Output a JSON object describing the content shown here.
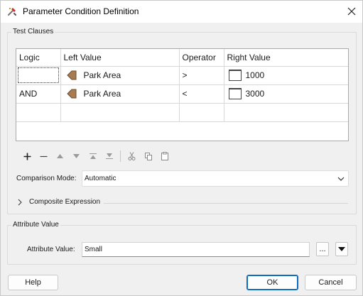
{
  "window": {
    "title": "Parameter Condition Definition",
    "icon": "fme-tool-icon"
  },
  "test_clauses": {
    "group_label": "Test Clauses",
    "columns": [
      "Logic",
      "Left Value",
      "Operator",
      "Right Value"
    ],
    "rows": [
      {
        "logic": "",
        "left_value": "Park Area",
        "left_icon": "attribute-icon",
        "operator": ">",
        "right_value": "1000",
        "right_icon": "constant-box-icon"
      },
      {
        "logic": "AND",
        "left_value": "Park Area",
        "left_icon": "attribute-icon",
        "operator": "<",
        "right_value": "3000",
        "right_icon": "constant-box-icon"
      },
      {
        "logic": "",
        "left_value": "",
        "left_icon": "",
        "operator": "",
        "right_value": "",
        "right_icon": ""
      }
    ],
    "toolbar": [
      "add-icon",
      "remove-icon",
      "move-up-icon",
      "move-down-icon",
      "move-to-top-icon",
      "move-to-bottom-icon",
      "cut-icon",
      "copy-icon",
      "paste-icon"
    ],
    "comparison_mode_label": "Comparison Mode:",
    "comparison_mode_value": "Automatic",
    "composite_expression_label": "Composite Expression"
  },
  "attribute_value": {
    "group_label": "Attribute Value",
    "field_label": "Attribute Value:",
    "field_value": "Small",
    "ellipsis_label": "..."
  },
  "buttons": {
    "help": "Help",
    "ok": "OK",
    "cancel": "Cancel"
  },
  "colors": {
    "accent": "#0f6cbd",
    "attribute_icon": "#a67c52"
  }
}
